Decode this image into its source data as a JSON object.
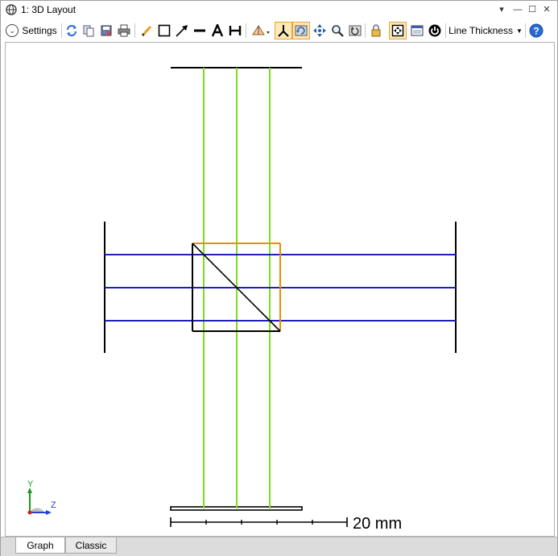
{
  "window": {
    "title": "1: 3D Layout",
    "controls": [
      "▾",
      "—",
      "☐",
      "✕"
    ]
  },
  "toolbar": {
    "settings_label": "Settings",
    "line_thickness_label": "Line Thickness",
    "icons": [
      "refresh-icon",
      "copy-icon",
      "save-icon",
      "print-icon",
      "pencil-icon",
      "rectangle-icon",
      "arrow-icon",
      "line-icon",
      "text-icon",
      "dimension-icon",
      "view-orientation-icon",
      "axis-icon",
      "rotate-icon",
      "pan-icon",
      "zoom-icon",
      "reset-view-icon",
      "lock-icon",
      "fit-icon",
      "window-icon",
      "power-icon",
      "help-icon"
    ]
  },
  "plot": {
    "scale_bar_label": "20 mm",
    "axis_y_label": "Y",
    "axis_z_label": "Z",
    "colors": {
      "vertical_rays": "#7ddc1f",
      "horizontal_rays": "#1f1fb4",
      "prism_outline": "#f08a00",
      "geometry": "#000000"
    }
  },
  "tabs": {
    "graph": "Graph",
    "classic": "Classic"
  }
}
